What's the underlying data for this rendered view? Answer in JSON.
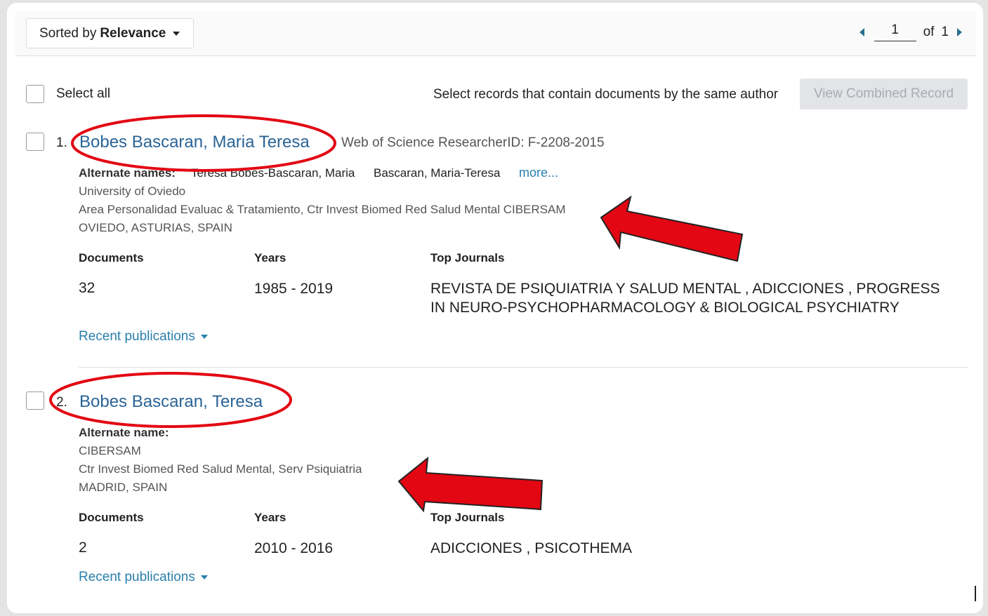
{
  "toolbar": {
    "sort_prefix": "Sorted by",
    "sort_value": "Relevance",
    "page_current": "1",
    "page_of_label": "of",
    "page_total": "1"
  },
  "selection": {
    "select_all_label": "Select all",
    "same_author_label": "Select records that contain documents by the same author",
    "combined_button_label": "View Combined Record"
  },
  "results": [
    {
      "number": "1.",
      "name": "Bobes Bascaran, Maria Teresa",
      "researcher_id": "Web of Science ResearcherID: F-2208-2015",
      "alt_label": "Alternate names:",
      "alt_names": [
        "Teresa Bobes-Bascaran, Maria",
        "Bascaran, Maria-Teresa"
      ],
      "more_label": "more...",
      "affiliations": [
        "University of Oviedo",
        "Area Personalidad Evaluac & Tratamiento, Ctr Invest Biomed Red Salud Mental CIBERSAM",
        "OVIEDO, ASTURIAS, SPAIN"
      ],
      "documents_label": "Documents",
      "years_label": "Years",
      "journals_label": "Top Journals",
      "documents": "32",
      "years": "1985 - 2019",
      "top_journals": "REVISTA DE PSIQUIATRIA Y SALUD MENTAL ,    ADICCIONES ,    PROGRESS IN NEURO-PSYCHOPHARMACOLOGY & BIOLOGICAL PSYCHIATRY",
      "recent_label": "Recent publications"
    },
    {
      "number": "2.",
      "name": "Bobes Bascaran, Teresa",
      "alt_label": "Alternate name:",
      "affiliations": [
        "CIBERSAM",
        "Ctr Invest Biomed Red Salud Mental, Serv Psiquiatria",
        "MADRID, SPAIN"
      ],
      "documents_label": "Documents",
      "years_label": "Years",
      "journals_label": "Top Journals",
      "documents": "2",
      "years": "2010 - 2016",
      "top_journals": "ADICCIONES ,    PSICOTHEMA",
      "recent_label": "Recent publications"
    }
  ],
  "annotation_colors": {
    "highlight": "#e30613",
    "arrow_outline": "#222222"
  }
}
